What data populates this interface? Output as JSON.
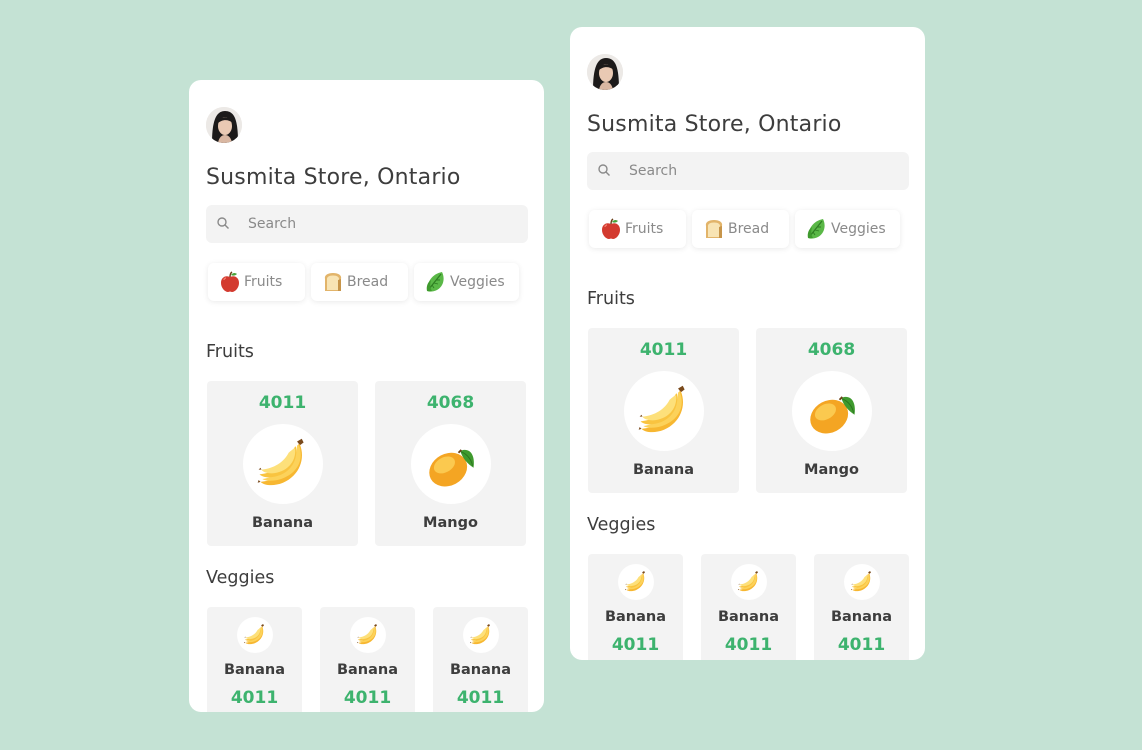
{
  "store": {
    "title": "Susmita Store, Ontario"
  },
  "search": {
    "placeholder": "Search",
    "value": ""
  },
  "categories": [
    {
      "label": "Fruits",
      "icon": "apple-icon"
    },
    {
      "label": "Bread",
      "icon": "bread-icon"
    },
    {
      "label": "Veggies",
      "icon": "lettuce-icon"
    }
  ],
  "sections": {
    "fruits": {
      "title": "Fruits",
      "items": [
        {
          "code": "4011",
          "name": "Banana",
          "icon": "banana-icon"
        },
        {
          "code": "4068",
          "name": "Mango",
          "icon": "mango-icon"
        }
      ]
    },
    "veggies": {
      "title": "Veggies",
      "items": [
        {
          "code": "4011",
          "name": "Banana",
          "icon": "banana-icon"
        },
        {
          "code": "4011",
          "name": "Banana",
          "icon": "banana-icon"
        },
        {
          "code": "4011",
          "name": "Banana",
          "icon": "banana-icon"
        }
      ]
    }
  },
  "colors": {
    "background": "#c4e2d4",
    "card": "#ffffff",
    "accent_green": "#3db36e",
    "tile": "#f3f3f3",
    "text": "#3d3d3d",
    "muted": "#8a8a8a"
  }
}
